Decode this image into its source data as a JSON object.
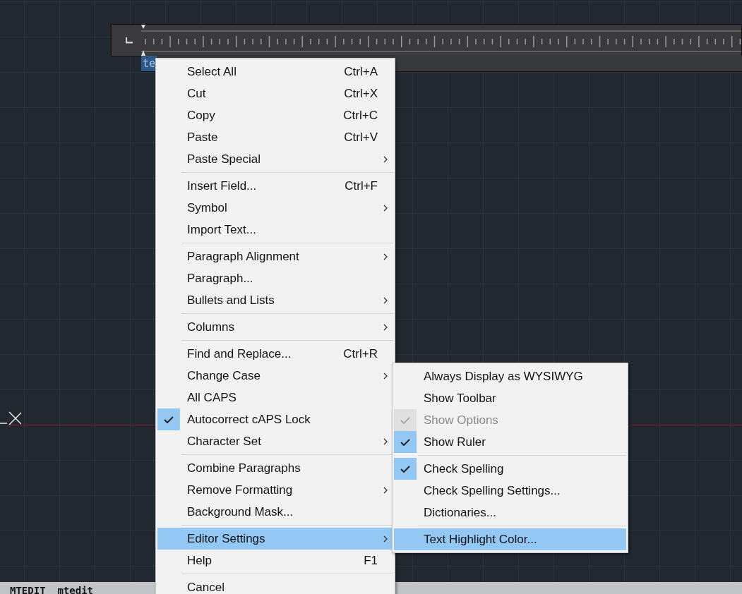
{
  "canvas": {
    "selected_text": "te",
    "command_line": "MTEDIT  mtedit"
  },
  "context_menu": {
    "groups": [
      [
        {
          "label": "Select All",
          "shortcut": "Ctrl+A",
          "submenu": false,
          "checked": false,
          "selected": false
        },
        {
          "label": "Cut",
          "shortcut": "Ctrl+X",
          "submenu": false,
          "checked": false,
          "selected": false
        },
        {
          "label": "Copy",
          "shortcut": "Ctrl+C",
          "submenu": false,
          "checked": false,
          "selected": false
        },
        {
          "label": "Paste",
          "shortcut": "Ctrl+V",
          "submenu": false,
          "checked": false,
          "selected": false
        },
        {
          "label": "Paste Special",
          "submenu": true,
          "checked": false,
          "selected": false
        }
      ],
      [
        {
          "label": "Insert Field...",
          "shortcut": "Ctrl+F",
          "submenu": false,
          "checked": false,
          "selected": false
        },
        {
          "label": "Symbol",
          "submenu": true,
          "checked": false,
          "selected": false
        },
        {
          "label": "Import Text...",
          "submenu": false,
          "checked": false,
          "selected": false
        }
      ],
      [
        {
          "label": "Paragraph Alignment",
          "submenu": true,
          "checked": false,
          "selected": false
        },
        {
          "label": "Paragraph...",
          "submenu": false,
          "checked": false,
          "selected": false
        },
        {
          "label": "Bullets and Lists",
          "submenu": true,
          "checked": false,
          "selected": false
        }
      ],
      [
        {
          "label": "Columns",
          "submenu": true,
          "checked": false,
          "selected": false
        }
      ],
      [
        {
          "label": "Find and Replace...",
          "shortcut": "Ctrl+R",
          "submenu": false,
          "checked": false,
          "selected": false
        },
        {
          "label": "Change Case",
          "submenu": true,
          "checked": false,
          "selected": false
        },
        {
          "label": "All CAPS",
          "submenu": false,
          "checked": false,
          "selected": false
        },
        {
          "label": "Autocorrect cAPS Lock",
          "submenu": false,
          "checked": true,
          "selected": false
        },
        {
          "label": "Character Set",
          "submenu": true,
          "checked": false,
          "selected": false
        }
      ],
      [
        {
          "label": "Combine Paragraphs",
          "submenu": false,
          "checked": false,
          "selected": false
        },
        {
          "label": "Remove Formatting",
          "submenu": true,
          "checked": false,
          "selected": false
        },
        {
          "label": "Background Mask...",
          "submenu": false,
          "checked": false,
          "selected": false
        }
      ],
      [
        {
          "label": "Editor Settings",
          "submenu": true,
          "checked": false,
          "selected": true
        },
        {
          "label": "Help",
          "shortcut": "F1",
          "submenu": false,
          "checked": false,
          "selected": false
        }
      ],
      [
        {
          "label": "Cancel",
          "submenu": false,
          "checked": false,
          "selected": false
        }
      ]
    ]
  },
  "submenu": {
    "groups": [
      [
        {
          "label": "Always Display as WYSIWYG",
          "checked": false,
          "disabled": false,
          "selected": false
        },
        {
          "label": "Show Toolbar",
          "checked": false,
          "disabled": false,
          "selected": false
        },
        {
          "label": "Show Options",
          "checked": true,
          "disabled": true,
          "selected": false
        },
        {
          "label": "Show Ruler",
          "checked": true,
          "disabled": false,
          "selected": false
        }
      ],
      [
        {
          "label": "Check Spelling",
          "checked": true,
          "disabled": false,
          "selected": false
        },
        {
          "label": "Check Spelling Settings...",
          "checked": false,
          "disabled": false,
          "selected": false
        },
        {
          "label": "Dictionaries...",
          "checked": false,
          "disabled": false,
          "selected": false
        }
      ],
      [
        {
          "label": "Text Highlight Color...",
          "checked": false,
          "disabled": false,
          "selected": true
        }
      ]
    ]
  }
}
